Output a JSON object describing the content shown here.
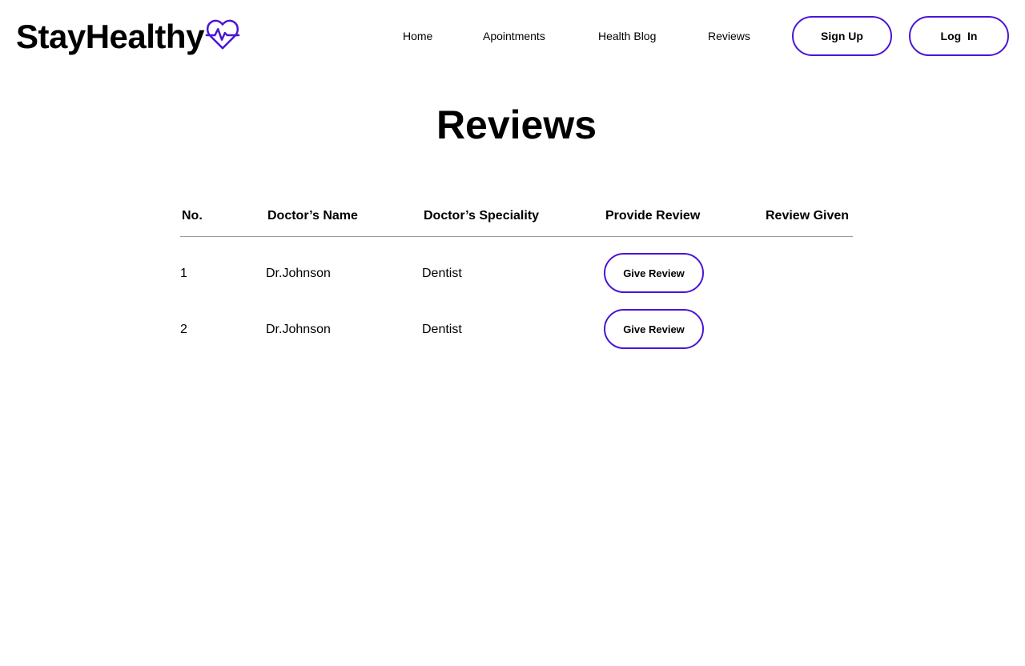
{
  "brand": {
    "name": "StayHealthy",
    "accent_color": "#4b14d6",
    "icon": "heart-pulse-icon"
  },
  "nav": {
    "items": [
      {
        "label": "Home"
      },
      {
        "label": "Apointments"
      },
      {
        "label": "Health Blog"
      },
      {
        "label": "Reviews"
      }
    ],
    "signup_label": "Sign Up",
    "login_label": "Log  In"
  },
  "page": {
    "title": "Reviews"
  },
  "table": {
    "columns": [
      "No.",
      "Doctor’s Name",
      "Doctor’s Speciality",
      "Provide Review",
      "Review Given"
    ],
    "rows": [
      {
        "no": "1",
        "name": "Dr.Johnson",
        "speciality": "Dentist",
        "action_label": "Give Review",
        "review_given": ""
      },
      {
        "no": "2",
        "name": "Dr.Johnson",
        "speciality": "Dentist",
        "action_label": "Give Review",
        "review_given": ""
      }
    ]
  }
}
